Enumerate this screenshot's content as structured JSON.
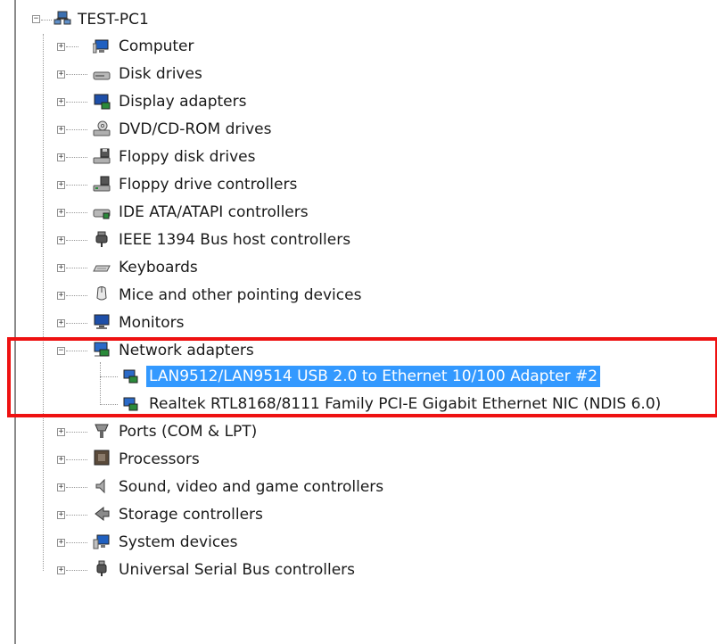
{
  "root": {
    "label": "TEST-PC1",
    "icon": "computer-network-icon"
  },
  "categories": [
    {
      "id": "computer",
      "label": "Computer",
      "icon": "computer-icon"
    },
    {
      "id": "disk-drives",
      "label": "Disk drives",
      "icon": "disk-drive-icon"
    },
    {
      "id": "display-adapters",
      "label": "Display adapters",
      "icon": "display-adapter-icon"
    },
    {
      "id": "dvd-cd-rom",
      "label": "DVD/CD-ROM drives",
      "icon": "dvd-drive-icon"
    },
    {
      "id": "floppy-disk",
      "label": "Floppy disk drives",
      "icon": "floppy-drive-icon"
    },
    {
      "id": "floppy-controllers",
      "label": "Floppy drive controllers",
      "icon": "floppy-controller-icon"
    },
    {
      "id": "ide-ata",
      "label": "IDE ATA/ATAPI controllers",
      "icon": "ide-controller-icon"
    },
    {
      "id": "ieee1394",
      "label": "IEEE 1394 Bus host controllers",
      "icon": "ieee1394-plug-icon"
    },
    {
      "id": "keyboards",
      "label": "Keyboards",
      "icon": "keyboard-icon"
    },
    {
      "id": "mice",
      "label": "Mice and other pointing devices",
      "icon": "mouse-icon"
    },
    {
      "id": "monitors",
      "label": "Monitors",
      "icon": "monitor-icon"
    },
    {
      "id": "network",
      "label": "Network adapters",
      "icon": "network-adapter-icon",
      "expanded": true
    },
    {
      "id": "ports",
      "label": "Ports (COM & LPT)",
      "icon": "port-icon"
    },
    {
      "id": "processors",
      "label": "Processors",
      "icon": "processor-icon"
    },
    {
      "id": "sound",
      "label": "Sound, video and game controllers",
      "icon": "speaker-icon"
    },
    {
      "id": "storage",
      "label": "Storage controllers",
      "icon": "storage-controller-icon"
    },
    {
      "id": "system",
      "label": "System devices",
      "icon": "system-devices-icon"
    },
    {
      "id": "usb",
      "label": "Universal Serial Bus controllers",
      "icon": "usb-plug-icon"
    }
  ],
  "network_children": [
    {
      "label": "LAN9512/LAN9514 USB 2.0 to Ethernet 10/100 Adapter #2",
      "icon": "network-adapter-icon",
      "selected": true
    },
    {
      "label": "Realtek RTL8168/8111 Family PCI-E Gigabit Ethernet NIC (NDIS 6.0)",
      "icon": "network-adapter-icon",
      "selected": false
    }
  ],
  "expander_collapsed": "+",
  "expander_expanded": "−",
  "colors": {
    "selection": "#3399ff",
    "highlight_box": "#ee1111"
  }
}
